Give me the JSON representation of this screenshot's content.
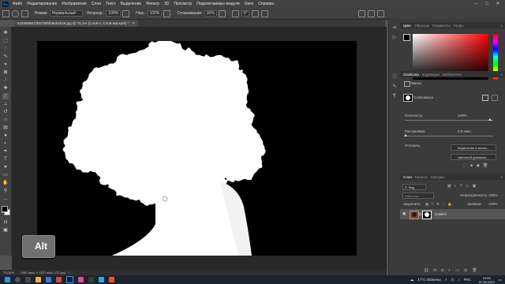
{
  "menu": [
    "Файл",
    "Редактирование",
    "Изображение",
    "Слои",
    "Текст",
    "Выделение",
    "Фильтр",
    "3D",
    "Просмотр",
    "Подключаемые модули",
    "Окно",
    "Справка"
  ],
  "options": {
    "mode_label": "Режим:",
    "mode_value": "Нормальный",
    "opacity_label": "Непрозр.:",
    "opacity_value": "100%",
    "pressure_label": "Наж.:",
    "pressure_value": "100%",
    "smoothing_label": "Сглаживание:",
    "smoothing_value": "10%",
    "angle_value": "0°"
  },
  "document": {
    "tab_title": "8449588672b5708f4b8e04b49.jpg @ 75,1% (Слой 0, Слой-маска/8) *"
  },
  "overlay": {
    "key_label": "Alt"
  },
  "status": {
    "zoom": "75,08%",
    "doc_info": "1990 пикс. x 1327 пикс. (72 ppi)"
  },
  "color_panel": {
    "tabs": [
      "Цвет",
      "Образцы",
      "Градиенты",
      "Узоры"
    ]
  },
  "properties_panel": {
    "tabs": [
      "Свойства",
      "Коррекция",
      "Библиотеки"
    ],
    "mask_label": "Маски",
    "layer_mask_label": "Слой-маска",
    "density_label": "Плотность:",
    "density_value": "100%",
    "feather_label": "Растушевка:",
    "feather_value": "0,0 пикс.",
    "refine_label": "Уточнить:",
    "select_mask_button": "Выделение и маска...",
    "color_range_button": "Цветовой диапазон..."
  },
  "layers_panel": {
    "tabs": [
      "Слои",
      "Каналы",
      "Контуры"
    ],
    "filter_label": "Вид",
    "blend_mode": "Обычные",
    "opacity_label": "Непрозрачность:",
    "opacity_value": "100%",
    "lock_label": "Закрепить:",
    "fill_label": "Заливка:",
    "fill_value": "100%",
    "layers": [
      {
        "name": "Слой 0"
      }
    ]
  },
  "taskbar": {
    "weather": "17°C Облачно",
    "lang": "РУС",
    "time": "19:53",
    "date": "07.05.2023"
  },
  "colors": {
    "accent": "#31a8ff",
    "bg": "#535353",
    "panel": "#3b3b3b",
    "foreground": "#000000",
    "background": "#ffffff"
  }
}
